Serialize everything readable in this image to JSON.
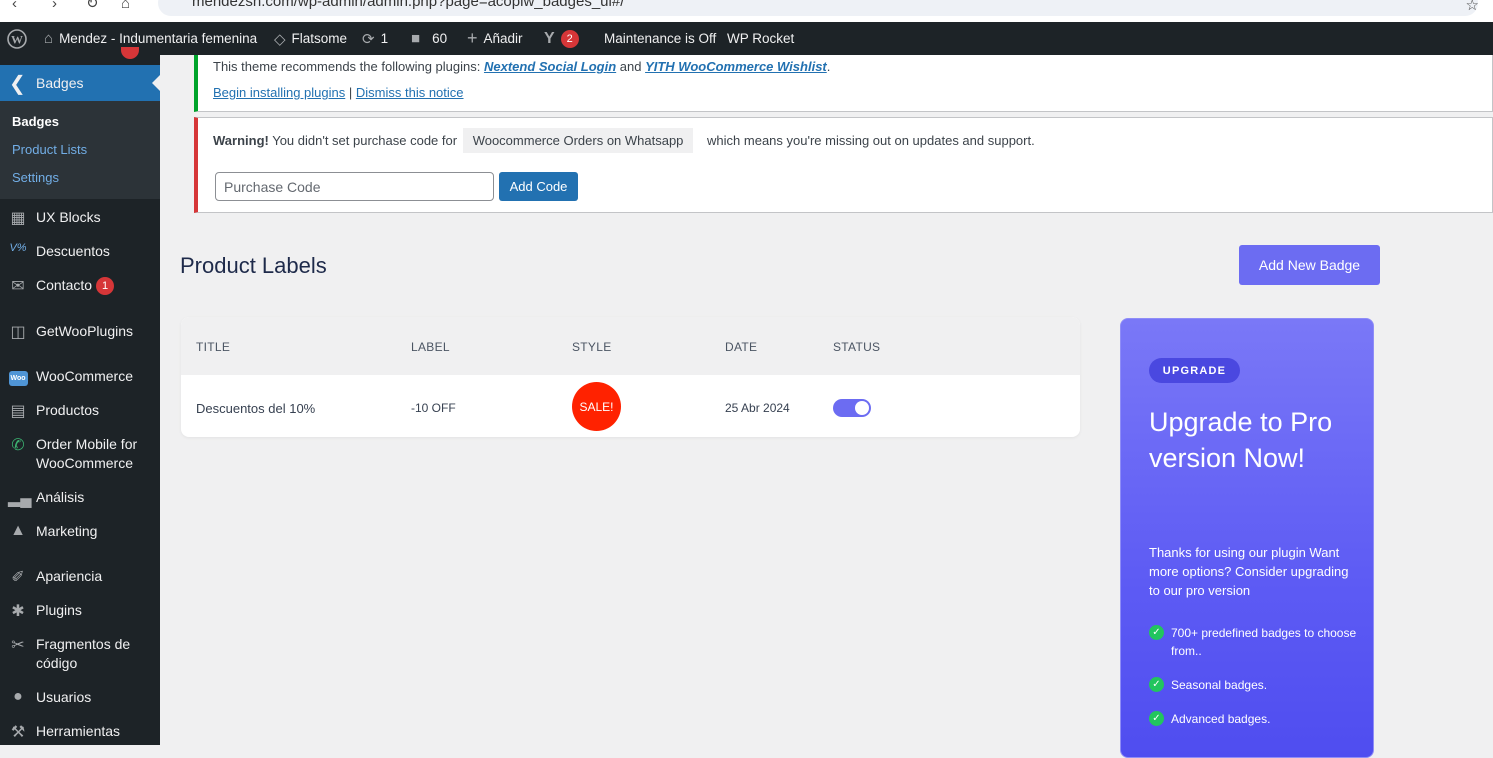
{
  "browser": {
    "url": "mendezsh.com/wp-admin/admin.php?page=acoplw_badges_ui#/"
  },
  "adminbar": {
    "site_name": "Mendez - Indumentaria femenina",
    "theme": "Flatsome",
    "updates": "1",
    "comments": "60",
    "new": "Añadir",
    "yoast_count": "2",
    "maintenance": "Maintenance is Off",
    "rocket": "WP Rocket"
  },
  "sidebar": {
    "current": "Badges",
    "submenu": [
      "Badges",
      "Product Lists",
      "Settings"
    ],
    "items": [
      {
        "label": "UX Blocks",
        "icon": "grid-icon"
      },
      {
        "label": "Descuentos",
        "icon": "discount-icon"
      },
      {
        "label": "Contacto",
        "icon": "mail-icon",
        "badge": "1"
      },
      {
        "label": "GetWooPlugins",
        "icon": "plugins-box-icon"
      },
      {
        "label": "WooCommerce",
        "icon": "woo-icon"
      },
      {
        "label": "Productos",
        "icon": "archive-icon"
      },
      {
        "label": "Order Mobile for WooCommerce",
        "icon": "whatsapp-icon"
      },
      {
        "label": "Análisis",
        "icon": "bar-chart-icon"
      },
      {
        "label": "Marketing",
        "icon": "megaphone-icon"
      },
      {
        "label": "Apariencia",
        "icon": "paintbrush-icon"
      },
      {
        "label": "Plugins",
        "icon": "plug-icon"
      },
      {
        "label": "Fragmentos de código",
        "icon": "scissors-icon"
      },
      {
        "label": "Usuarios",
        "icon": "user-icon"
      },
      {
        "label": "Herramientas",
        "icon": "wrench-icon"
      }
    ]
  },
  "notice_plugins": {
    "text_before": "This theme recommends the following plugins: ",
    "plugin1": "Nextend Social Login",
    "and": " and ",
    "plugin2": "YITH WooCommerce Wishlist",
    "period": ".",
    "begin": "Begin installing plugins",
    "sep": " | ",
    "dismiss": "Dismiss this notice"
  },
  "notice_warning": {
    "strong": "Warning!",
    "text1": " You didn't set purchase code for ",
    "plugin": "Woocommerce Orders on Whatsapp",
    "text2": " which means you're missing out on updates and support.",
    "input_placeholder": "Purchase Code",
    "button": "Add Code"
  },
  "main": {
    "title": "Product Labels",
    "add_button": "Add New Badge",
    "columns": [
      "TITLE",
      "LABEL",
      "STYLE",
      "DATE",
      "STATUS"
    ],
    "rows": [
      {
        "title": "Descuentos del 10%",
        "label": "-10 OFF",
        "style_badge": "SALE!",
        "date": "25 Abr 2024",
        "status_on": true
      }
    ]
  },
  "upgrade": {
    "pill": "UPGRADE",
    "title": "Upgrade to Pro version Now!",
    "desc": "Thanks for using our plugin Want more options? Consider upgrading to our pro version",
    "features": [
      "700+ predefined badges to choose from..",
      "Seasonal badges.",
      "Advanced badges."
    ]
  },
  "colors": {
    "wp_blue": "#2271b1",
    "accent": "#6c6cf2",
    "sale_red": "#ff2200",
    "admin_dark": "#1d2327"
  }
}
